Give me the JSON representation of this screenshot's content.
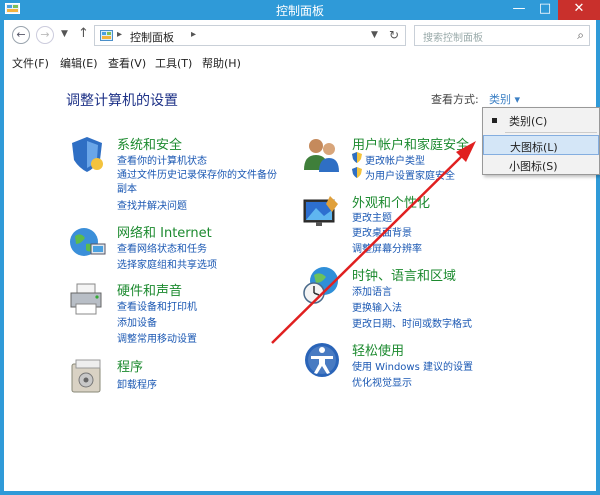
{
  "window": {
    "title": "控制面板",
    "minimize": "—",
    "maximize": "□",
    "close": "✕"
  },
  "address": {
    "crumb": "控制面板",
    "search_placeholder": "搜索控制面板"
  },
  "menu": [
    "文件(F)",
    "编辑(E)",
    "查看(V)",
    "工具(T)",
    "帮助(H)"
  ],
  "main": {
    "heading": "调整计算机的设置",
    "view_by_label": "查看方式:",
    "view_by_value": "类别 ▾"
  },
  "view_menu": {
    "items": [
      "类别(C)",
      "大图标(L)",
      "小图标(S)"
    ],
    "selected": "类别(C)",
    "hovered": "大图标(L)"
  },
  "categories_left": [
    {
      "title": "系统和安全",
      "links": [
        "查看你的计算机状态",
        "通过文件历史记录保存你的文件备份",
        "副本",
        "查找并解决问题"
      ]
    },
    {
      "title": "网络和 Internet",
      "links": [
        "查看网络状态和任务",
        "选择家庭组和共享选项"
      ]
    },
    {
      "title": "硬件和声音",
      "links": [
        "查看设备和打印机",
        "添加设备",
        "调整常用移动设置"
      ]
    },
    {
      "title": "程序",
      "links": [
        "卸载程序"
      ]
    }
  ],
  "categories_right": [
    {
      "title": "用户帐户和家庭安全",
      "links": [
        "更改帐户类型",
        "为用户设置家庭安全"
      ]
    },
    {
      "title": "外观和个性化",
      "links": [
        "更改主题",
        "更改桌面背景",
        "调整屏幕分辨率"
      ]
    },
    {
      "title": "时钟、语言和区域",
      "links": [
        "添加语言",
        "更换输入法",
        "更改日期、时间或数字格式"
      ]
    },
    {
      "title": "轻松使用",
      "links": [
        "使用 Windows 建议的设置",
        "优化视觉显示"
      ]
    }
  ],
  "colors": {
    "titlebar": "#2f9ad8",
    "category_title": "#1c8a2f",
    "link": "#1b58b3",
    "heading": "#1e3287",
    "arrow": "#e02020"
  }
}
